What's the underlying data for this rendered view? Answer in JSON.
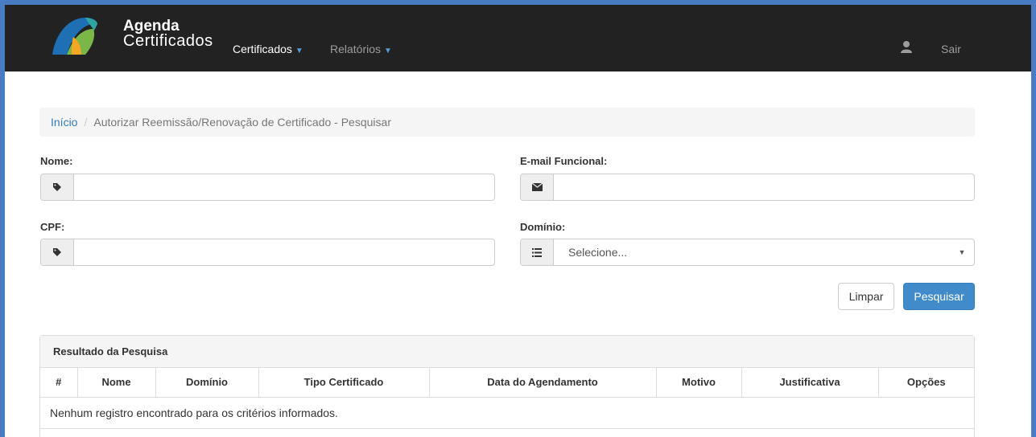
{
  "header": {
    "brand_line1": "Agenda",
    "brand_line2": "Certificados",
    "nav": [
      {
        "label": "Certificados",
        "active": true
      },
      {
        "label": "Relatórios",
        "active": false
      }
    ],
    "logout_label": "Sair"
  },
  "breadcrumb": {
    "home": "Início",
    "separator": "/",
    "current": "Autorizar Reemissão/Renovação de Certificado - Pesquisar"
  },
  "form": {
    "nome_label": "Nome:",
    "nome_value": "",
    "email_label": "E-mail Funcional:",
    "email_value": "",
    "cpf_label": "CPF:",
    "cpf_value": "",
    "dominio_label": "Domínio:",
    "dominio_selected": "Selecione...",
    "clear_label": "Limpar",
    "search_label": "Pesquisar"
  },
  "results": {
    "title": "Resultado da Pesquisa",
    "columns": [
      "#",
      "Nome",
      "Domínio",
      "Tipo Certificado",
      "Data do Agendamento",
      "Motivo",
      "Justificativa",
      "Opções"
    ],
    "empty_message": "Nenhum registro encontrado para os critérios informados."
  },
  "colors": {
    "navbar": "#222222",
    "primary": "#428bca",
    "link": "#337ab7",
    "frame": "#4a7cc4"
  }
}
